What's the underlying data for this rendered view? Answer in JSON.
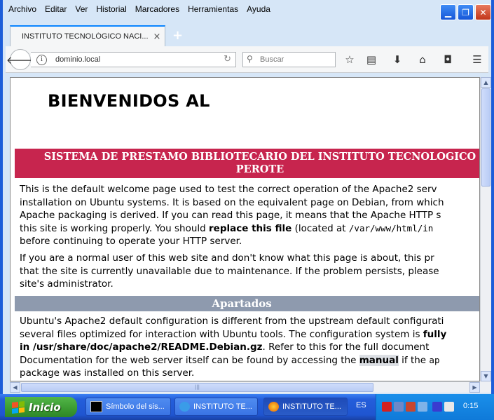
{
  "menu": [
    "Archivo",
    "Editar",
    "Ver",
    "Historial",
    "Marcadores",
    "Herramientas",
    "Ayuda"
  ],
  "tab": {
    "title": "INSTITUTO TECNOLÓGICO NACI...",
    "close": "×",
    "new_tab": "+"
  },
  "nav": {
    "url": "dominio.local",
    "search_placeholder": "Buscar"
  },
  "page": {
    "heading": "BIENVENIDOS AL",
    "banner_line1": "SISTEMA DE PRESTAMO BIBLIOTECARIO DEL INSTITUTO TECNOLOGICO",
    "banner_line2": "PEROTE",
    "p1": {
      "l1": "This is the default welcome page used to test the correct operation of the Apache2 serv",
      "l2": "installation on Ubuntu systems. It is based on the equivalent page on Debian, from which",
      "l3": "Apache packaging is derived. If you can read this page, it means that the Apache HTTP s",
      "l4a": "this site is working properly. You should ",
      "l4b": "replace this file",
      "l4c": " (located at ",
      "l4d": "/var/www/html/in",
      "l5": "before continuing to operate your HTTP server."
    },
    "p2": {
      "l1": "If you are a normal user of this web site and don't know what this page is about, this pr",
      "l2": "that the site is currently unavailable due to maintenance. If the problem persists, please",
      "l3": "site's administrator."
    },
    "section_title": "Apartados",
    "p3": {
      "l1": "Ubuntu's Apache2 default configuration is different from the upstream default configurati",
      "l2a": "several files optimized for interaction with Ubuntu tools. The configuration system is ",
      "l2b": "fully",
      "l3a": "in /usr/share/doc/apache2/README.Debian.gz",
      "l3b": ". Refer to this for the full document",
      "l4a": "Documentation for the web server itself can be found by accessing the ",
      "l4b": "manual",
      "l4c": " if the ",
      "l4d": "ap",
      "l5": "package was installed on this server."
    }
  },
  "taskbar": {
    "start": "Inicio",
    "tasks": [
      "Símbolo del sis...",
      "INSTITUTO TE...",
      "INSTITUTO TE..."
    ],
    "lang": "ES",
    "clock": "0:15"
  }
}
